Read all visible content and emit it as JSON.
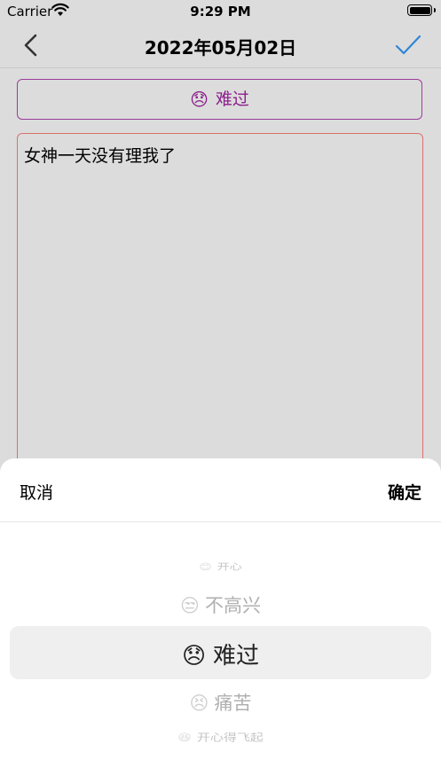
{
  "status": {
    "carrier": "Carrier",
    "time": "9:29 PM"
  },
  "nav": {
    "title": "2022年05月02日"
  },
  "mood": {
    "emoji": "😞",
    "label": "难过"
  },
  "diary": {
    "text": "女神一天没有理我了"
  },
  "sheet": {
    "cancel_label": "取消",
    "confirm_label": "确定",
    "options": [
      {
        "emoji": "😊",
        "label": "开心"
      },
      {
        "emoji": "😒",
        "label": "不高兴"
      },
      {
        "emoji": "😞",
        "label": "难过"
      },
      {
        "emoji": "😣",
        "label": "痛苦"
      },
      {
        "emoji": "😆",
        "label": "开心得飞起"
      }
    ],
    "selected_index": 2
  }
}
